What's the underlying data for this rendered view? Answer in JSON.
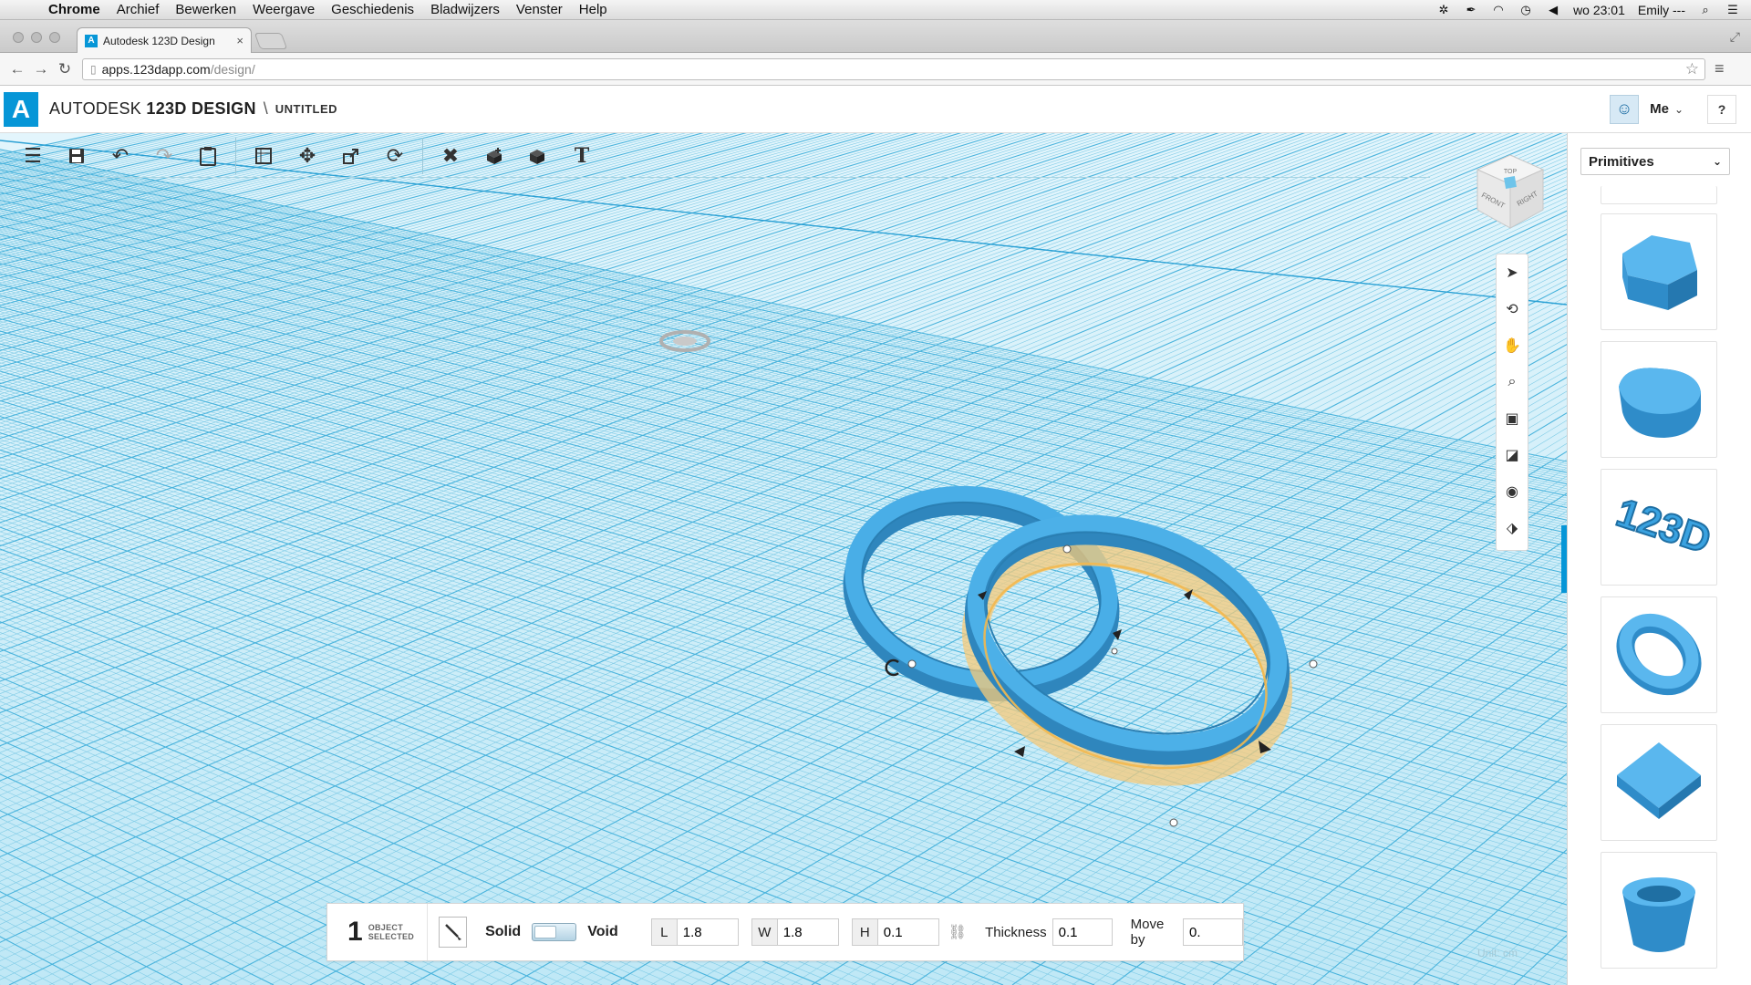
{
  "menubar": {
    "app": "Chrome",
    "items": [
      "Archief",
      "Bewerken",
      "Weergave",
      "Geschiedenis",
      "Bladwijzers",
      "Venster",
      "Help"
    ],
    "clock": "wo 23:01",
    "user": "Emily ---"
  },
  "browser": {
    "tab_title": "Autodesk 123D Design",
    "tab_close": "×",
    "url_host": "apps.123dapp.com",
    "url_path": "/design/"
  },
  "app": {
    "brand_light": "AUTODESK",
    "brand_bold": "123D DESIGN",
    "document_title": "UNTITLED",
    "user_label": "Me",
    "help_label": "?"
  },
  "viewcube": {
    "top": "TOP",
    "front": "FRONT",
    "right": "RIGHT"
  },
  "panel": {
    "category": "Primitives"
  },
  "properties": {
    "selected_count": "1",
    "selected_line1": "OBJECT",
    "selected_line2": "SELECTED",
    "solid_label": "Solid",
    "void_label": "Void",
    "length_label": "L",
    "length_value": "1.8",
    "width_label": "W",
    "width_value": "1.8",
    "height_label": "H",
    "height_value": "0.1",
    "thickness_label": "Thickness",
    "thickness_value": "0.1",
    "moveby_label": "Move by",
    "moveby_value": "0."
  },
  "viewport": {
    "unit_label": "Unit:  cm"
  },
  "colors": {
    "accent": "#0696d7",
    "grid_bg": "#bfe8f6",
    "shape_blue": "#3aa2e0",
    "selection_orange": "#f5c97a"
  }
}
